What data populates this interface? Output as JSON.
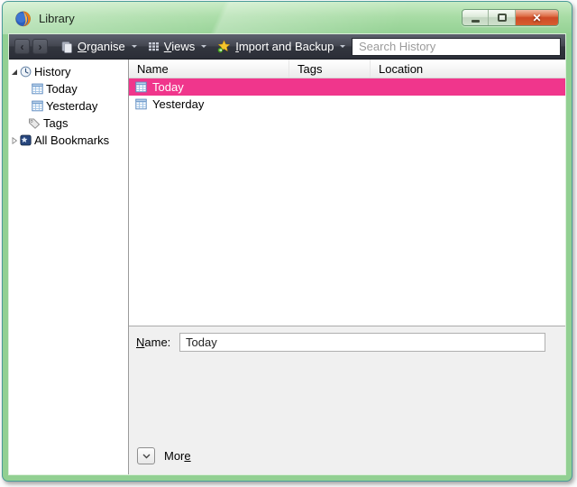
{
  "window": {
    "title": "Library",
    "controls": {
      "minimize": "minimize-button",
      "maximize": "maximize-button",
      "close": "close-button"
    }
  },
  "icons": {
    "firefox": "firefox-logo",
    "back_glyph": "‹",
    "forward_glyph": "›",
    "close_glyph": "✕",
    "organise": "pages-icon",
    "views": "grid-icon",
    "import_backup": "star-icon",
    "history": "clock-icon",
    "day": "calendar-icon",
    "tags": "tag-icon",
    "all_bookmarks": "bookmark-folder-icon",
    "more": "chevron-down-icon"
  },
  "toolbar": {
    "organise": {
      "key": "O",
      "post": "rganise"
    },
    "views": {
      "key": "V",
      "post": "iews"
    },
    "import_backup": {
      "key": "I",
      "post": "mport and Backup"
    },
    "search": {
      "placeholder": "Search History",
      "value": ""
    }
  },
  "sidebar": {
    "items": [
      {
        "label": "History",
        "icon": "clock-icon",
        "state": "expanded"
      },
      {
        "label": "Today",
        "icon": "calendar-icon",
        "state": "leaf"
      },
      {
        "label": "Yesterday",
        "icon": "calendar-icon",
        "state": "leaf"
      },
      {
        "label": "Tags",
        "icon": "tag-icon",
        "state": "leaf"
      },
      {
        "label": "All Bookmarks",
        "icon": "bookmark-folder-icon",
        "state": "collapsed"
      }
    ]
  },
  "list": {
    "columns": [
      "Name",
      "Tags",
      "Location"
    ],
    "rows": [
      {
        "name": "Today",
        "tags": "",
        "location": "",
        "selected": true
      },
      {
        "name": "Yesterday",
        "tags": "",
        "location": "",
        "selected": false
      }
    ]
  },
  "details": {
    "name_label": {
      "key": "N",
      "post": "ame:"
    },
    "name_value": "Today",
    "more": {
      "pre": "Mor",
      "key": "e"
    }
  },
  "colors": {
    "selection": "#F0368C",
    "frame_green": "#92d092",
    "toolbar_dark": "#3a3d47"
  }
}
